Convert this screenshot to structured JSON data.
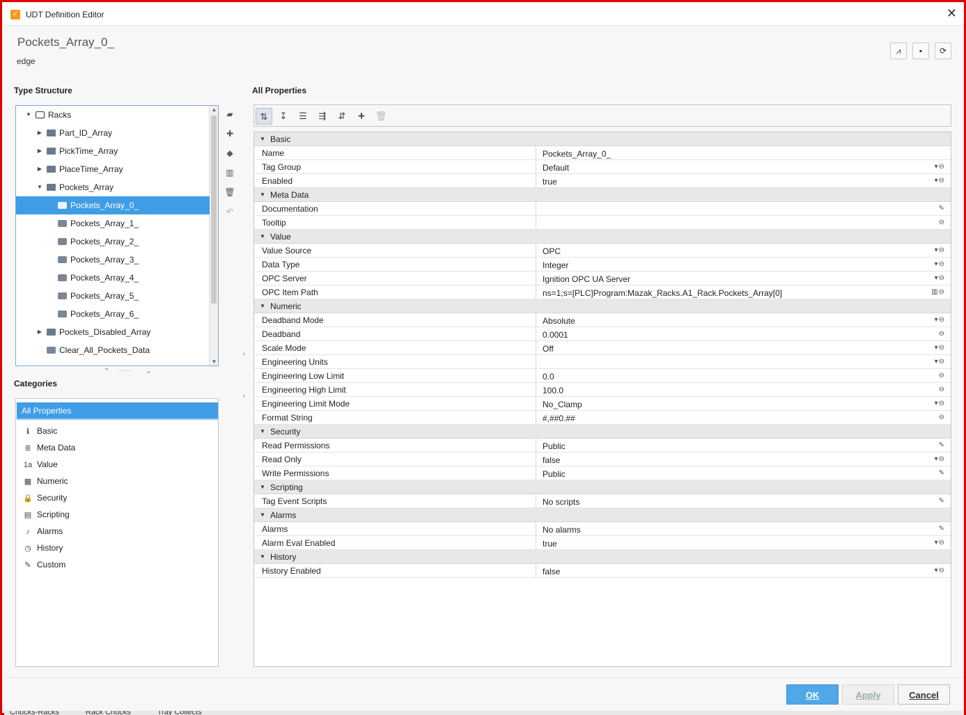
{
  "window": {
    "title": "UDT Definition Editor",
    "close_icon": "close-icon"
  },
  "header": {
    "tag_name": "Pockets_Array_0_",
    "tag_provider": "edge"
  },
  "header_buttons": [
    {
      "icon": "diagnostics-icon",
      "glyph": "⟂"
    },
    {
      "icon": "note-icon",
      "glyph": "▪"
    },
    {
      "icon": "refresh-icon",
      "glyph": "⟳"
    }
  ],
  "type_structure": {
    "label": "Type Structure",
    "items": [
      {
        "label": "Racks",
        "depth": 0,
        "expanded": true,
        "kind": "udt"
      },
      {
        "label": "Part_ID_Array",
        "depth": 1,
        "expanded": false,
        "kind": "folder"
      },
      {
        "label": "PickTime_Array",
        "depth": 1,
        "expanded": false,
        "kind": "folder"
      },
      {
        "label": "PlaceTime_Array",
        "depth": 1,
        "expanded": false,
        "kind": "folder"
      },
      {
        "label": "Pockets_Array",
        "depth": 1,
        "expanded": true,
        "kind": "folder"
      },
      {
        "label": "Pockets_Array_0_",
        "depth": 2,
        "kind": "tag",
        "selected": true
      },
      {
        "label": "Pockets_Array_1_",
        "depth": 2,
        "kind": "tag"
      },
      {
        "label": "Pockets_Array_2_",
        "depth": 2,
        "kind": "tag"
      },
      {
        "label": "Pockets_Array_3_",
        "depth": 2,
        "kind": "tag"
      },
      {
        "label": "Pockets_Array_4_",
        "depth": 2,
        "kind": "tag"
      },
      {
        "label": "Pockets_Array_5_",
        "depth": 2,
        "kind": "tag"
      },
      {
        "label": "Pockets_Array_6_",
        "depth": 2,
        "kind": "tag"
      },
      {
        "label": "Pockets_Disabled_Array",
        "depth": 1,
        "expanded": false,
        "kind": "folder"
      },
      {
        "label": "Clear_All_Pockets_Data",
        "depth": 1,
        "kind": "tag"
      }
    ]
  },
  "side_tools": [
    "new-folder-icon",
    "new-tag-icon",
    "tag-icon",
    "columns-icon",
    "delete-icon",
    "undo-icon"
  ],
  "categories": {
    "label": "Categories",
    "selected": "All Properties",
    "items": [
      {
        "label": "Basic",
        "icon": "info-icon",
        "glyph": "ℹ"
      },
      {
        "label": "Meta Data",
        "icon": "database-icon",
        "glyph": "≣"
      },
      {
        "label": "Value",
        "icon": "value-icon",
        "glyph": "1a"
      },
      {
        "label": "Numeric",
        "icon": "calculator-icon",
        "glyph": "▦"
      },
      {
        "label": "Security",
        "icon": "lock-icon",
        "glyph": "🔒"
      },
      {
        "label": "Scripting",
        "icon": "script-icon",
        "glyph": "▤"
      },
      {
        "label": "Alarms",
        "icon": "bell-icon",
        "glyph": "♪"
      },
      {
        "label": "History",
        "icon": "clock-icon",
        "glyph": "◷"
      },
      {
        "label": "Custom",
        "icon": "wrench-icon",
        "glyph": "✎"
      }
    ]
  },
  "properties": {
    "label": "All Properties",
    "toolbar": [
      "sort-category-icon",
      "sort-alpha-icon",
      "list-icon",
      "expand-all-icon",
      "collapse-all-icon",
      "add-icon",
      "delete-icon"
    ],
    "rows": [
      {
        "type": "cat",
        "name": "Basic"
      },
      {
        "type": "prop",
        "name": "Name",
        "value": "Pockets_Array_0_",
        "icons": ""
      },
      {
        "type": "prop",
        "name": "Tag Group",
        "value": "Default",
        "icons": "▾⊖"
      },
      {
        "type": "prop",
        "name": "Enabled",
        "value": "true",
        "icons": "▾⊖"
      },
      {
        "type": "cat",
        "name": "Meta Data"
      },
      {
        "type": "prop",
        "name": "Documentation",
        "value": "",
        "icons": "✎"
      },
      {
        "type": "prop",
        "name": "Tooltip",
        "value": "",
        "icons": "⊖"
      },
      {
        "type": "cat",
        "name": "Value"
      },
      {
        "type": "prop",
        "name": "Value Source",
        "value": "OPC",
        "icons": "▾⊖"
      },
      {
        "type": "prop",
        "name": "Data Type",
        "value": "Integer",
        "icons": "▾⊖"
      },
      {
        "type": "prop",
        "name": "OPC Server",
        "value": "Ignition OPC UA Server",
        "icons": "▾⊖"
      },
      {
        "type": "prop",
        "name": "OPC Item Path",
        "value": "ns=1;s=[PLC]Program:Mazak_Racks.A1_Rack.Pockets_Array[0]",
        "icons": "▥⊖"
      },
      {
        "type": "cat",
        "name": "Numeric"
      },
      {
        "type": "prop",
        "name": "Deadband Mode",
        "value": "Absolute",
        "icons": "▾⊖"
      },
      {
        "type": "prop",
        "name": "Deadband",
        "value": "0.0001",
        "icons": "⊖"
      },
      {
        "type": "prop",
        "name": "Scale Mode",
        "value": "Off",
        "icons": "▾⊖"
      },
      {
        "type": "prop",
        "name": "Engineering Units",
        "value": "",
        "icons": "▾⊖"
      },
      {
        "type": "prop",
        "name": "Engineering Low Limit",
        "value": "0.0",
        "icons": "⊖"
      },
      {
        "type": "prop",
        "name": "Engineering High Limit",
        "value": "100.0",
        "icons": "⊖"
      },
      {
        "type": "prop",
        "name": "Engineering Limit Mode",
        "value": "No_Clamp",
        "icons": "▾⊖"
      },
      {
        "type": "prop",
        "name": "Format String",
        "value": "#,##0.##",
        "icons": "⊖"
      },
      {
        "type": "cat",
        "name": "Security"
      },
      {
        "type": "prop",
        "name": "Read Permissions",
        "value": "Public",
        "icons": "✎"
      },
      {
        "type": "prop",
        "name": "Read Only",
        "value": "false",
        "icons": "▾⊖"
      },
      {
        "type": "prop",
        "name": "Write Permissions",
        "value": "Public",
        "icons": "✎"
      },
      {
        "type": "cat",
        "name": "Scripting"
      },
      {
        "type": "prop",
        "name": "Tag Event Scripts",
        "value": "No scripts",
        "icons": "✎"
      },
      {
        "type": "cat",
        "name": "Alarms"
      },
      {
        "type": "prop",
        "name": "Alarms",
        "value": "No alarms",
        "icons": "✎"
      },
      {
        "type": "prop",
        "name": "Alarm Eval Enabled",
        "value": "true",
        "icons": "▾⊖"
      },
      {
        "type": "cat",
        "name": "History"
      },
      {
        "type": "prop",
        "name": "History Enabled",
        "value": "false",
        "icons": "▾⊖"
      }
    ]
  },
  "footer": {
    "ok": "OK",
    "apply": "Apply",
    "cancel": "Cancel"
  },
  "background_tabs": [
    "Chucks-Racks",
    "Rack Chucks",
    "Tray Collects"
  ],
  "colors": {
    "selection": "#3f9de5",
    "ok_button": "#4fa9e8",
    "frame_border": "#e00000"
  }
}
